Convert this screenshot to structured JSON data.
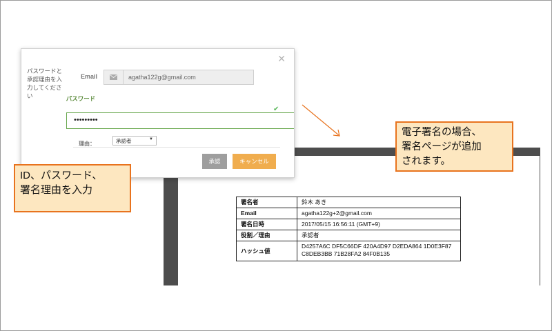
{
  "dialog": {
    "close_icon": "close-icon",
    "instructions": "パスワードと承認理由を入力してください",
    "email_label": "Email",
    "email_icon": "envelope-icon",
    "email_value": "agatha122g@gmail.com",
    "password_label": "パスワード",
    "password_value": "•••••••••",
    "password_valid_icon": "check-icon",
    "reason_label": "理由：",
    "reason_selected": "承認者",
    "approve_label": "承認",
    "cancel_label": "キャンセル"
  },
  "callouts": {
    "left": [
      "ID、パスワード、",
      "署名理由を入力"
    ],
    "right": [
      "電子署名の場合、",
      "署名ページが追加",
      "されます。"
    ]
  },
  "signature_table": {
    "rows": [
      {
        "key": "署名者",
        "value": "鈴木 あき"
      },
      {
        "key": "Email",
        "value": "agatha122g+2@gmail.com"
      },
      {
        "key": "署名日時",
        "value": "2017/05/15 16:56:11 (GMT+9)"
      },
      {
        "key": "役割／理由",
        "value": "承認者"
      },
      {
        "key": "ハッシュ値",
        "value": "D4257A6C DF5C66DF 420A4D97 D2EDA864 1D0E3F87 C8DEB3BB 71B28FA2 84F0B135"
      }
    ]
  },
  "colors": {
    "accent_orange": "#e8731e",
    "callout_fill": "#fde7c0",
    "cancel_button": "#f0ad4e",
    "approve_button": "#9e9e9e",
    "valid_green": "#6aa84f"
  }
}
